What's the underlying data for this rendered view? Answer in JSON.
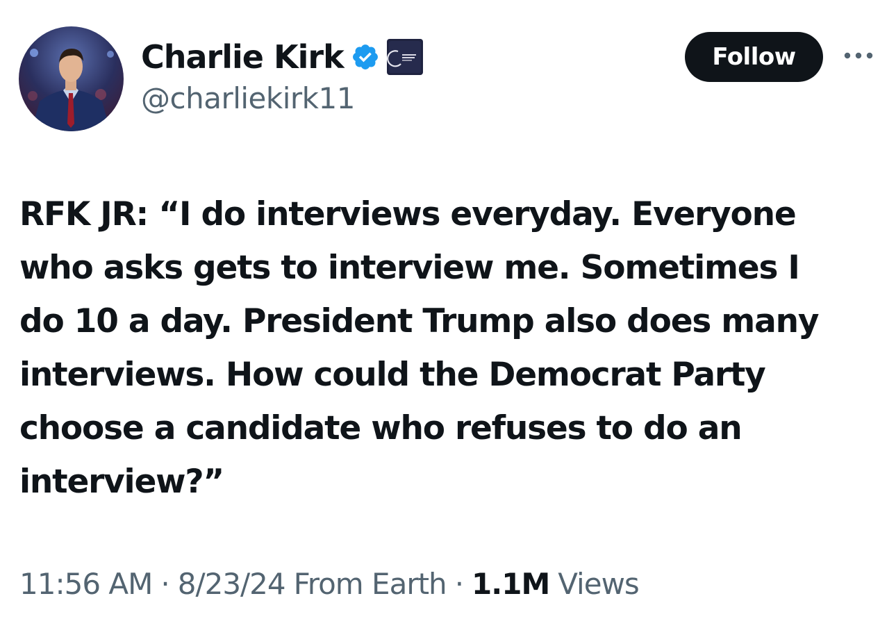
{
  "author": {
    "display_name": "Charlie Kirk",
    "handle": "@charliekirk11",
    "verified_badge_color": "#1d9bf0",
    "avatar_icon": "profile-photo",
    "affiliate_badge_icon": "turning-point-usa-logo"
  },
  "actions": {
    "follow_label": "Follow",
    "more_icon": "more-horizontal-icon"
  },
  "tweet": {
    "lines": [
      "RFK JR: “I do interviews everyday. Everyone",
      "who asks gets to interview me. Sometimes I",
      "do 10 a day. President Trump also does many",
      "interviews. How could the Democrat Party",
      "choose a candidate who refuses to do an",
      "interview?”"
    ]
  },
  "meta": {
    "time": "11:56 AM",
    "separator": "·",
    "date": "8/23/24",
    "source": "From Earth",
    "views_count": "1.1M",
    "views_label": "Views"
  },
  "colors": {
    "text_primary": "#0f1419",
    "text_secondary": "#536471",
    "button_bg": "#0f1419",
    "background": "#ffffff"
  }
}
